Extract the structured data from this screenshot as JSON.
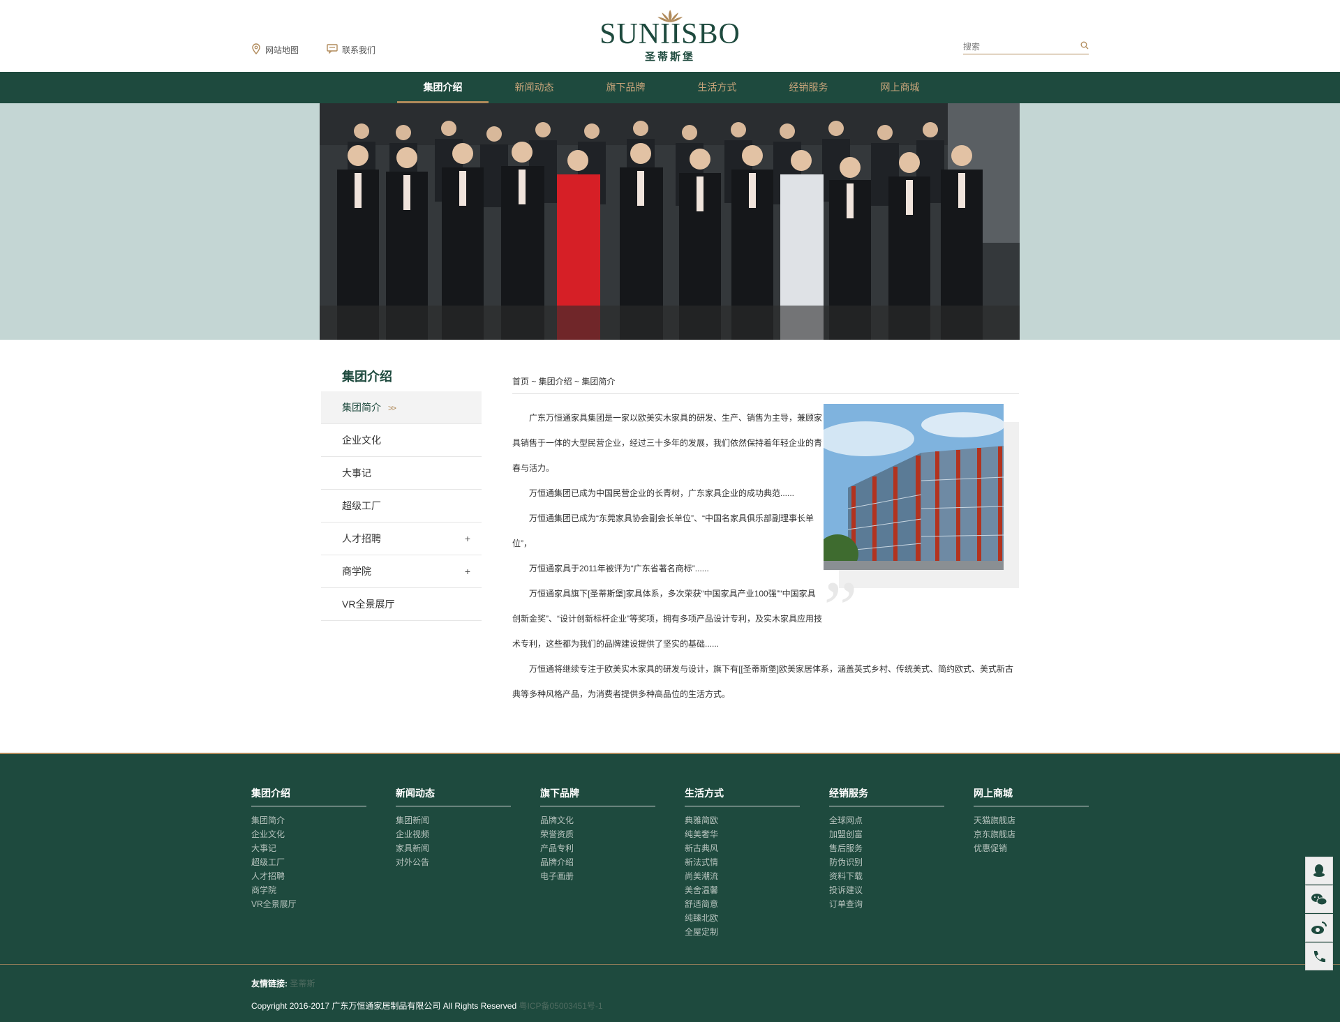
{
  "header": {
    "sitemap_label": "网站地图",
    "contact_label": "联系我们",
    "logo_en": "SUNIISBO",
    "logo_cn": "圣蒂斯堡",
    "search_placeholder": "搜索"
  },
  "nav": [
    {
      "label": "集团介绍",
      "active": true
    },
    {
      "label": "新闻动态"
    },
    {
      "label": "旗下品牌"
    },
    {
      "label": "生活方式"
    },
    {
      "label": "经销服务"
    },
    {
      "label": "网上商城"
    }
  ],
  "sidebar": {
    "title": "集团介绍",
    "items": [
      {
        "label": "集团简介",
        "active": true,
        "arrows": ">>"
      },
      {
        "label": "企业文化"
      },
      {
        "label": "大事记"
      },
      {
        "label": "超级工厂"
      },
      {
        "label": "人才招聘",
        "plus": "+"
      },
      {
        "label": "商学院",
        "plus": "+"
      },
      {
        "label": "VR全景展厅"
      }
    ]
  },
  "breadcrumb": "首页 ~ 集团介绍 ~ 集团简介",
  "content": {
    "paragraphs": [
      "广东万恒通家具集团是一家以欧美实木家具的研发、生产、销售为主导，兼顾家具销售于一体的大型民营企业，经过三十多年的发展，我们依然保持着年轻企业的青春与活力。",
      "万恒通集团已成为中国民营企业的长青树，广东家具企业的成功典范......",
      "万恒通集团已成为“东莞家具协会副会长单位”、“中国名家具俱乐部副理事长单位”，",
      "万恒通家具于2011年被评为“广东省著名商标”......",
      "万恒通家具旗下[圣蒂斯堡]家具体系，多次荣获“中国家具产业100强”“中国家具创新金奖”、“设计创新标杆企业”等奖项，拥有多项产品设计专利，及实木家具应用技术专利，这些都为我们的品牌建设提供了坚实的基础......",
      "万恒通将继续专注于欧美实木家具的研发与设计，旗下有[[圣蒂斯堡]欧美家居体系，涵盖英式乡村、传统美式、简约欧式、美式新古典等多种风格产品，为消费者提供多种高品位的生活方式。"
    ]
  },
  "footer": {
    "columns": [
      {
        "title": "集团介绍",
        "links": [
          "集团简介",
          "企业文化",
          "大事记",
          "超级工厂",
          "人才招聘",
          "商学院",
          "VR全景展厅"
        ]
      },
      {
        "title": "新闻动态",
        "links": [
          "集团新闻",
          "企业视频",
          "家具新闻",
          "对外公告"
        ]
      },
      {
        "title": "旗下品牌",
        "links": [
          "品牌文化",
          "荣誉资质",
          "产品专利",
          "品牌介绍",
          "电子画册"
        ]
      },
      {
        "title": "生活方式",
        "links": [
          "典雅简欧",
          "纯美奢华",
          "新古典风",
          "新法式情",
          "尚美潮流",
          "美舍温馨",
          "舒适简意",
          "纯臻北欧",
          "全屋定制"
        ]
      },
      {
        "title": "经销服务",
        "links": [
          "全球网点",
          "加盟创富",
          "售后服务",
          "防伪识别",
          "资料下载",
          "投诉建议",
          "订单查询"
        ]
      },
      {
        "title": "网上商城",
        "links": [
          "天猫旗舰店",
          "京东旗舰店",
          "优惠促销"
        ]
      }
    ],
    "links_label": "友情链接:",
    "links_value": "圣蒂斯",
    "copyright": "Copyright  2016-2017  广东万恒通家居制品有限公司 All Rights Reserved",
    "icp": "粤ICP备05003451号-1"
  },
  "side_tools": [
    "qq-icon",
    "wechat-icon",
    "weibo-icon",
    "phone-icon"
  ]
}
